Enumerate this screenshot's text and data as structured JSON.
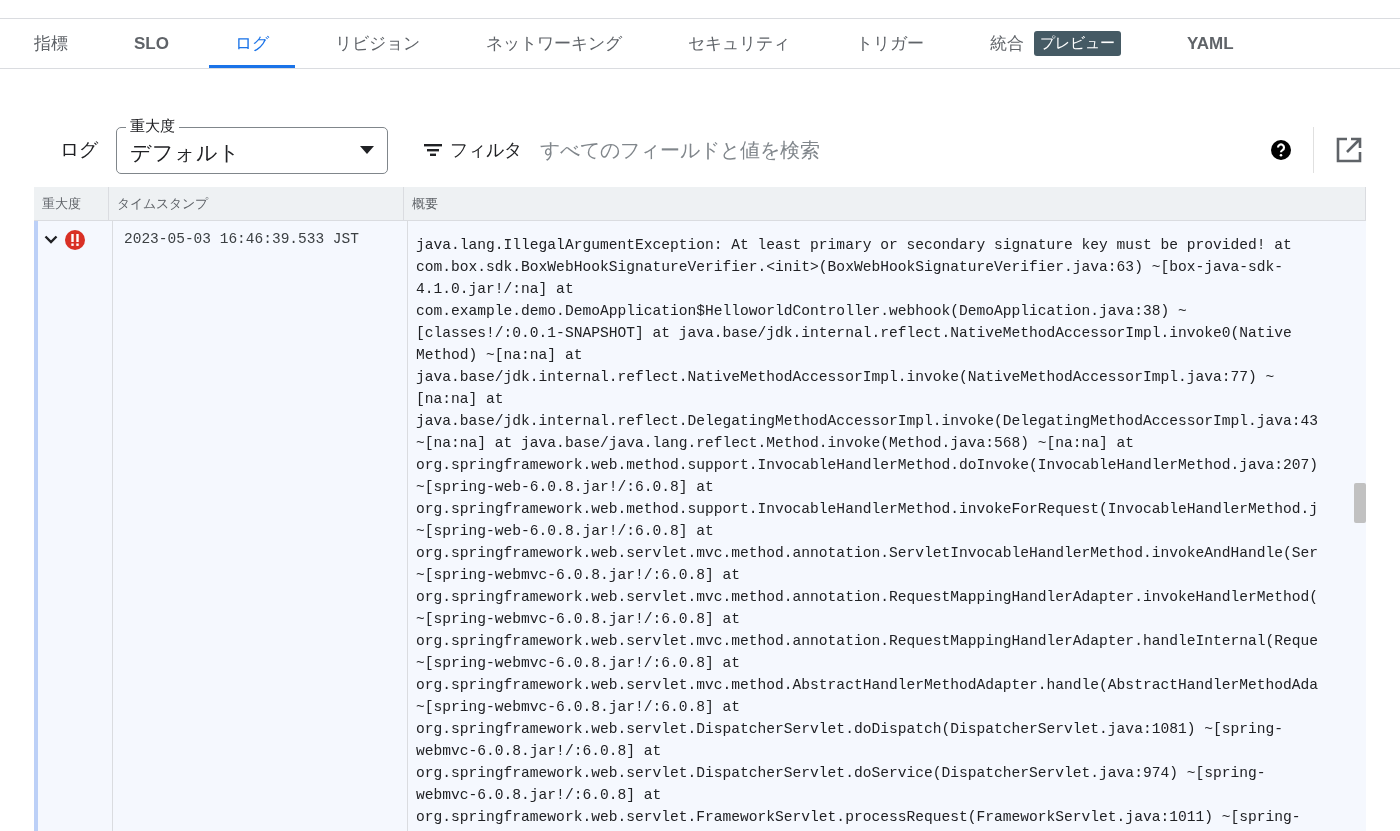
{
  "tabs": [
    {
      "label": "指標",
      "selected": false,
      "bold": false
    },
    {
      "label": "SLO",
      "selected": false,
      "bold": true
    },
    {
      "label": "ログ",
      "selected": true,
      "bold": false
    },
    {
      "label": "リビジョン",
      "selected": false,
      "bold": false
    },
    {
      "label": "ネットワーキング",
      "selected": false,
      "bold": false
    },
    {
      "label": "セキュリティ",
      "selected": false,
      "bold": false
    },
    {
      "label": "トリガー",
      "selected": false,
      "bold": false
    },
    {
      "label": "統合",
      "selected": false,
      "bold": false,
      "badge": "プレビュー"
    },
    {
      "label": "YAML",
      "selected": false,
      "bold": true
    }
  ],
  "toolbar": {
    "title": "ログ",
    "severity_select": {
      "label": "重大度",
      "value": "デフォルト"
    },
    "filter_label": "フィルタ",
    "search": {
      "placeholder": "すべてのフィールドと値を検索"
    }
  },
  "table": {
    "columns": [
      "重大度",
      "タイムスタンプ",
      "概要"
    ],
    "rows": [
      {
        "expanded": true,
        "kind": "error",
        "timestamp": "2023-05-03 16:46:39.533 JST",
        "message_lines": [
          "java.lang.IllegalArgumentException: At least primary or secondary signature key must be provided! at",
          "com.box.sdk.BoxWebHookSignatureVerifier.<init>(BoxWebHookSignatureVerifier.java:63) ~[box-java-sdk-",
          "4.1.0.jar!/:na] at",
          "com.example.demo.DemoApplication$HelloworldController.webhook(DemoApplication.java:38) ~",
          "[classes!/:0.0.1-SNAPSHOT] at java.base/jdk.internal.reflect.NativeMethodAccessorImpl.invoke0(Native",
          "Method) ~[na:na] at",
          "java.base/jdk.internal.reflect.NativeMethodAccessorImpl.invoke(NativeMethodAccessorImpl.java:77) ~",
          "[na:na] at",
          "java.base/jdk.internal.reflect.DelegatingMethodAccessorImpl.invoke(DelegatingMethodAccessorImpl.java:43",
          "~[na:na] at java.base/java.lang.reflect.Method.invoke(Method.java:568) ~[na:na] at",
          "org.springframework.web.method.support.InvocableHandlerMethod.doInvoke(InvocableHandlerMethod.java:207)",
          "~[spring-web-6.0.8.jar!/:6.0.8] at",
          "org.springframework.web.method.support.InvocableHandlerMethod.invokeForRequest(InvocableHandlerMethod.j",
          "~[spring-web-6.0.8.jar!/:6.0.8] at",
          "org.springframework.web.servlet.mvc.method.annotation.ServletInvocableHandlerMethod.invokeAndHandle(Ser",
          "~[spring-webmvc-6.0.8.jar!/:6.0.8] at",
          "org.springframework.web.servlet.mvc.method.annotation.RequestMappingHandlerAdapter.invokeHandlerMethod(",
          "~[spring-webmvc-6.0.8.jar!/:6.0.8] at",
          "org.springframework.web.servlet.mvc.method.annotation.RequestMappingHandlerAdapter.handleInternal(Reque",
          "~[spring-webmvc-6.0.8.jar!/:6.0.8] at",
          "org.springframework.web.servlet.mvc.method.AbstractHandlerMethodAdapter.handle(AbstractHandlerMethodAda",
          "~[spring-webmvc-6.0.8.jar!/:6.0.8] at",
          "org.springframework.web.servlet.DispatcherServlet.doDispatch(DispatcherServlet.java:1081) ~[spring-",
          "webmvc-6.0.8.jar!/:6.0.8] at",
          "org.springframework.web.servlet.DispatcherServlet.doService(DispatcherServlet.java:974) ~[spring-",
          "webmvc-6.0.8.jar!/:6.0.8] at",
          "org.springframework.web.servlet.FrameworkServlet.processRequest(FrameworkServlet.java:1011) ~[spring-"
        ]
      }
    ]
  }
}
